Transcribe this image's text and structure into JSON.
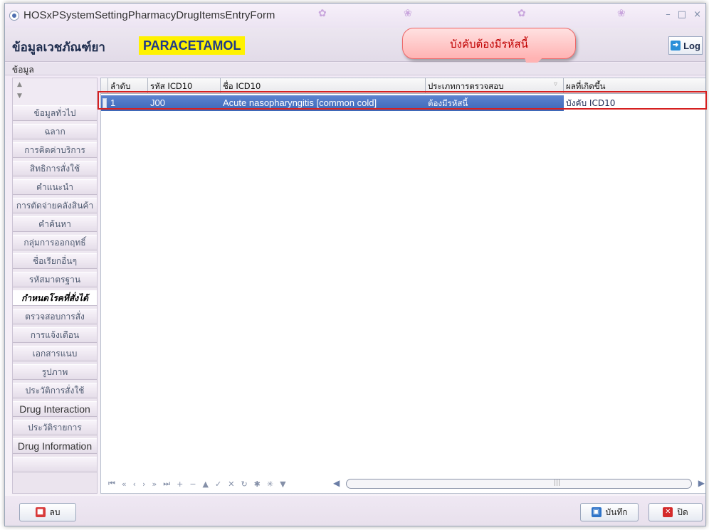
{
  "window": {
    "title": "HOSxPSystemSettingPharmacyDrugItemsEntryForm"
  },
  "header": {
    "caption": "ข้อมูลเวชภัณฑ์ยา",
    "drug_name": "PARACETAMOL",
    "callout": "บังคับต้องมีรหัสนี้",
    "log_label": "Log"
  },
  "menu": {
    "data_label": "ข้อมูล"
  },
  "sidebar": {
    "items": [
      {
        "label": "ข้อมูลทั่วไป"
      },
      {
        "label": "ฉลาก"
      },
      {
        "label": "การคิดค่าบริการ"
      },
      {
        "label": "สิทธิการสั่งใช้"
      },
      {
        "label": "คำแนะนำ"
      },
      {
        "label": "การตัดจ่ายคลังสินค้า"
      },
      {
        "label": "คำค้นหา"
      },
      {
        "label": "กลุ่มการออกฤทธิ์"
      },
      {
        "label": "ชื่อเรียกอื่นๆ"
      },
      {
        "label": "รหัสมาตรฐาน"
      },
      {
        "label": "กำหนดโรคที่สั่งได้"
      },
      {
        "label": "ตรวจสอบการสั่ง"
      },
      {
        "label": "การแจ้งเตือน"
      },
      {
        "label": "เอกสารแนบ"
      },
      {
        "label": "รูปภาพ"
      },
      {
        "label": "ประวัติการสั่งใช้"
      },
      {
        "label": "Drug Interaction"
      },
      {
        "label": "ประวัติรายการ"
      },
      {
        "label": "Drug Information"
      }
    ],
    "active_index": 10
  },
  "grid": {
    "columns": [
      "ลำดับ",
      "รหัส ICD10",
      "ชื่อ ICD10",
      "ประเภทการตรวจสอบ",
      "ผลที่เกิดขึ้น"
    ],
    "rows": [
      {
        "seq": "1",
        "icd10": "J00",
        "name": "Acute nasopharyngitis [common cold]",
        "check_type": "ต้องมีรหัสนี้",
        "result": "บังคับ ICD10"
      }
    ]
  },
  "buttons": {
    "delete": "ลบ",
    "save": "บันทึก",
    "close": "ปิด"
  }
}
